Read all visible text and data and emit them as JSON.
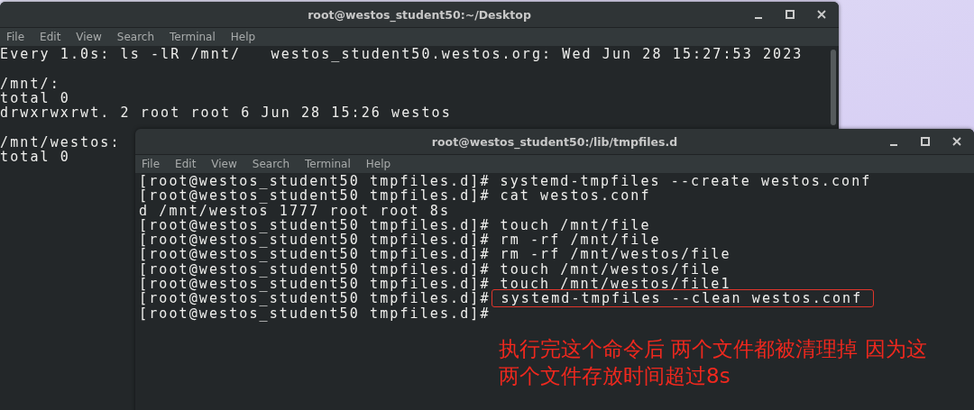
{
  "back_window": {
    "title": "root@westos_student50:~/Desktop",
    "menu": [
      "File",
      "Edit",
      "View",
      "Search",
      "Terminal",
      "Help"
    ],
    "blocks": [
      [
        "Every 1.0s: ls -lR /mnt/   westos_student50.westos.org: Wed Jun 28 15:27:53 2023"
      ],
      [
        "/mnt/:",
        "total 0",
        "drwxrwxrwt. 2 root root 6 Jun 28 15:26 westos"
      ],
      [
        "/mnt/westos:",
        "total 0"
      ]
    ]
  },
  "front_window": {
    "title": "root@westos_student50:/lib/tmpfiles.d",
    "menu": [
      "File",
      "Edit",
      "View",
      "Search",
      "Terminal",
      "Help"
    ],
    "lines": [
      {
        "kind": "prompt",
        "prompt": "[root@westos_student50 tmpfiles.d]#",
        "command": "systemd-tmpfiles --create westos.conf",
        "highlighted": false
      },
      {
        "kind": "prompt",
        "prompt": "[root@westos_student50 tmpfiles.d]#",
        "command": "cat westos.conf",
        "highlighted": false
      },
      {
        "kind": "output",
        "text": "d /mnt/westos 1777 root root 8s"
      },
      {
        "kind": "prompt",
        "prompt": "[root@westos_student50 tmpfiles.d]#",
        "command": "touch /mnt/file",
        "highlighted": false
      },
      {
        "kind": "prompt",
        "prompt": "[root@westos_student50 tmpfiles.d]#",
        "command": "rm -rf /mnt/file",
        "highlighted": false
      },
      {
        "kind": "prompt",
        "prompt": "[root@westos_student50 tmpfiles.d]#",
        "command": "rm -rf /mnt/westos/file",
        "highlighted": false
      },
      {
        "kind": "prompt",
        "prompt": "[root@westos_student50 tmpfiles.d]#",
        "command": "touch /mnt/westos/file",
        "highlighted": false
      },
      {
        "kind": "prompt",
        "prompt": "[root@westos_student50 tmpfiles.d]#",
        "command": "touch /mnt/westos/file1",
        "highlighted": false
      },
      {
        "kind": "prompt",
        "prompt": "[root@westos_student50 tmpfiles.d]#",
        "command": "systemd-tmpfiles --clean westos.conf",
        "highlighted": true
      },
      {
        "kind": "prompt",
        "prompt": "[root@westos_student50 tmpfiles.d]#"
      }
    ]
  },
  "annotation": [
    "执行完这个命令后 两个文件都被清理掉 因为这",
    "两个文件存放时间超过8s"
  ]
}
